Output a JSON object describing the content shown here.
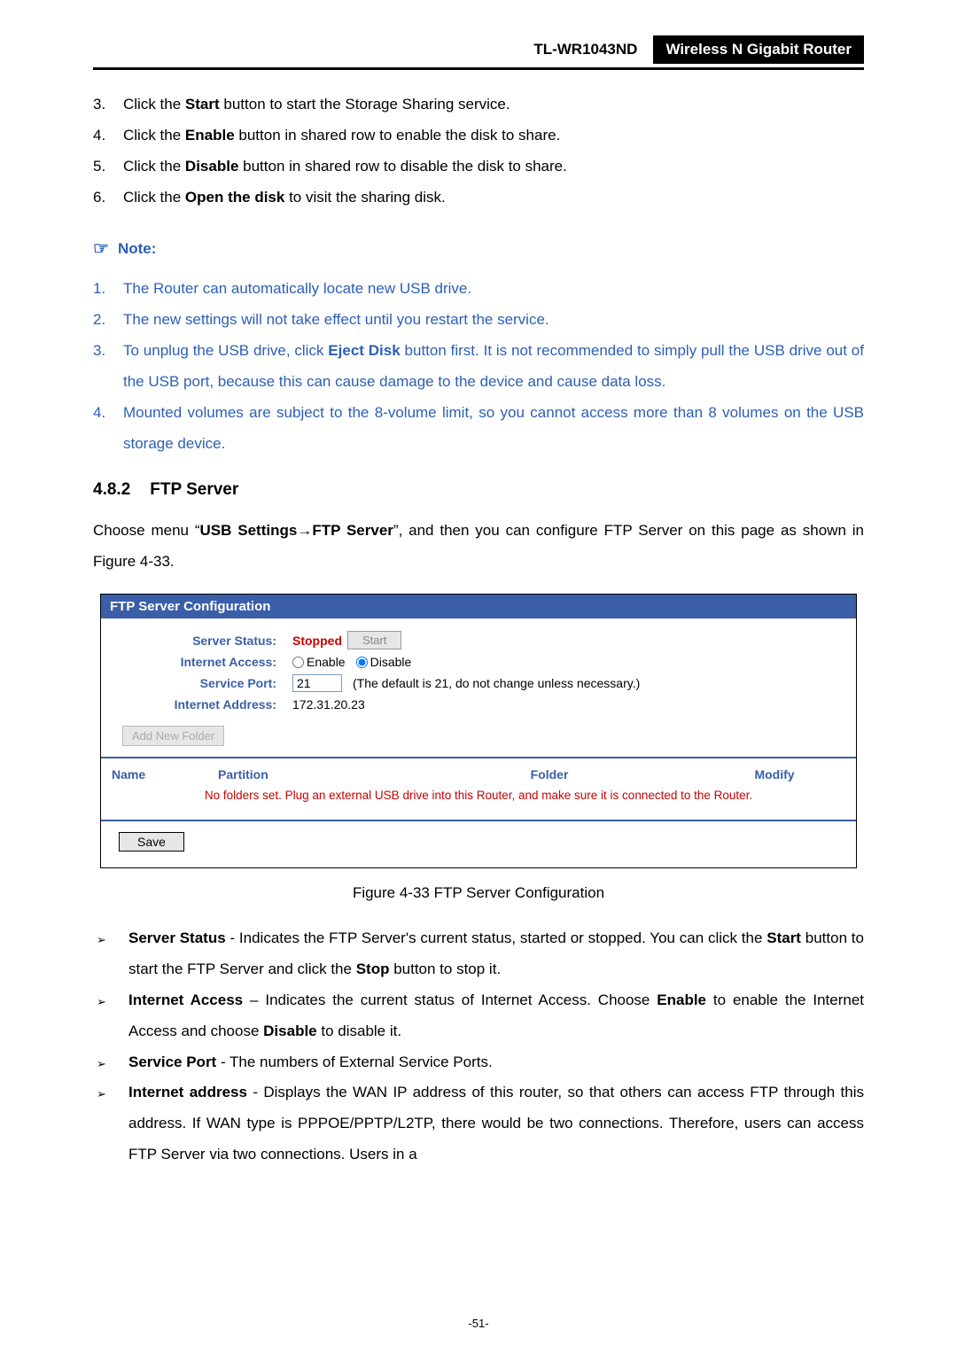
{
  "header": {
    "model": "TL-WR1043ND",
    "title": "Wireless N Gigabit Router"
  },
  "steps": [
    {
      "n": "3.",
      "pre": "Click the ",
      "bold": "Start",
      "post": " button to start the Storage Sharing service."
    },
    {
      "n": "4.",
      "pre": "Click the ",
      "bold": "Enable",
      "post": " button in shared row to enable the disk to share."
    },
    {
      "n": "5.",
      "pre": "Click the ",
      "bold": "Disable",
      "post": " button in shared row to disable the disk to share."
    },
    {
      "n": "6.",
      "pre": "Click the ",
      "bold": "Open the disk",
      "post": " to visit the sharing disk."
    }
  ],
  "note_label": "Note:",
  "notes": [
    {
      "n": "1.",
      "text": "The Router can automatically locate new USB drive."
    },
    {
      "n": "2.",
      "text": "The new settings will not take effect until you restart the service."
    },
    {
      "n": "3.",
      "text_html": "To unplug the USB drive, click <b>Eject Disk</b> button first. It is not recommended to simply pull the USB drive out of the USB port, because this can cause damage to the device and cause data loss."
    },
    {
      "n": "4.",
      "text": "Mounted volumes are subject to the 8-volume limit, so you cannot access more than 8 volumes on the USB storage device."
    }
  ],
  "section": {
    "num": "4.8.2",
    "title": "FTP Server"
  },
  "intro_html": "Choose menu “<b>USB Settings</b>→<b>FTP Server</b>”, and then you can configure FTP Server on this page as shown in Figure 4-33.",
  "panel": {
    "title": "FTP Server Configuration",
    "rows": {
      "status": {
        "label": "Server Status:",
        "value": "Stopped",
        "button": "Start"
      },
      "access": {
        "label": "Internet Access:",
        "enable": "Enable",
        "disable": "Disable"
      },
      "port": {
        "label": "Service Port:",
        "value": "21",
        "hint": "(The default is 21, do not change unless necessary.)"
      },
      "addr": {
        "label": "Internet Address:",
        "value": "172.31.20.23"
      }
    },
    "add_folder": "Add New Folder",
    "table_headers": {
      "name": "Name",
      "partition": "Partition",
      "folder": "Folder",
      "modify": "Modify"
    },
    "no_folders": "No folders set. Plug an external USB drive into this Router, and make sure it is connected to the Router.",
    "save": "Save"
  },
  "fig_caption": "Figure 4-33 FTP Server Configuration",
  "defs": [
    {
      "html": "<b>Server Status</b> - Indicates the FTP Server's current status, started or stopped. You can click the <b>Start</b> button to start the FTP Server and click the <b>Stop</b> button to stop it."
    },
    {
      "html": "<b>Internet Access</b> – Indicates the current status of Internet Access. Choose <b>Enable</b> to enable the Internet Access and choose <b>Disable</b> to disable it."
    },
    {
      "html": "<b>Service Port</b> - The numbers of External Service Ports."
    },
    {
      "html": "<b>Internet address</b> - Displays the WAN IP address of this router, so that others can access FTP through this address. If WAN type is PPPOE/PPTP/L2TP, there would be two connections. Therefore, users can access FTP Server via two connections. Users in a"
    }
  ],
  "page_num": "-51-"
}
